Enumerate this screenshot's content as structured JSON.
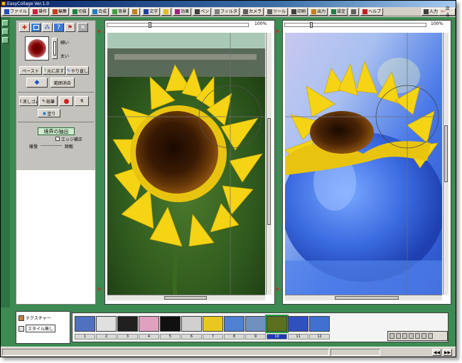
{
  "window": {
    "title": "EasyCollage Ver.1.0"
  },
  "toolbar": {
    "items": [
      {
        "label": "ファイル",
        "icon": "folder-icon",
        "color": "#2050c0"
      },
      {
        "label": "操作",
        "icon": "heart-icon",
        "color": "#d02040"
      },
      {
        "label": "編集",
        "icon": "scissors-icon",
        "color": "#c04020"
      },
      {
        "label": "切抜",
        "icon": "crop-icon",
        "color": "#208040"
      },
      {
        "label": "合成",
        "icon": "layers-icon",
        "color": "#2080c0"
      },
      {
        "label": "背景",
        "icon": "landscape-icon",
        "color": "#40a040"
      },
      {
        "label": "",
        "icon": "frame-icon",
        "color": "#c08020"
      },
      {
        "label": "文字",
        "icon": "text-icon",
        "color": "#2040a0"
      },
      {
        "label": "",
        "icon": "star-icon",
        "color": "#e0c020"
      },
      {
        "label": "効果",
        "icon": "effect-icon",
        "color": "#a02080"
      },
      {
        "label": "ペン",
        "icon": "pen-icon",
        "color": "#404040"
      },
      {
        "label": "フィルタ",
        "icon": "filter-icon",
        "color": "#808080"
      },
      {
        "label": "カメラ",
        "icon": "camera-icon",
        "color": "#606060"
      },
      {
        "label": "ツール",
        "icon": "tool-icon",
        "color": "#606060"
      },
      {
        "label": "印刷",
        "icon": "print-icon",
        "color": "#404040"
      },
      {
        "label": "出力",
        "icon": "export-icon",
        "color": "#c08020"
      },
      {
        "label": "設定",
        "icon": "settings-icon",
        "color": "#208040"
      },
      {
        "label": "",
        "icon": "grid-icon",
        "color": "#606060"
      },
      {
        "label": "ヘルプ",
        "icon": "help-icon",
        "color": "#c02020"
      }
    ],
    "right_items": [
      {
        "label": "入力",
        "icon": "input-icon"
      },
      {
        "label": "戻る",
        "icon": "back-arrow-icon"
      }
    ]
  },
  "left_panel": {
    "size_small": "細い",
    "size_large": "太い",
    "buttons_row1": [
      "ペースト",
      "元に戻す",
      "やり直し"
    ],
    "buttons_row2": [
      "",
      "範囲消去"
    ],
    "buttons_row3": [
      "消しゴム",
      "鉛筆",
      "",
      ""
    ],
    "fill_label": "塗り",
    "action_label": "境界の抽出",
    "edge_label": "エッジ補正",
    "slider_left": "緩慢",
    "slider_right": "鋭敏"
  },
  "left_view": {
    "zoom_label": "100%",
    "slider": 0.3
  },
  "right_view": {
    "zoom_label": "100%",
    "slider": 0.18
  },
  "layer_panel": {
    "rows": [
      {
        "label": "テクスチャー"
      },
      {
        "label": "スタイル無し"
      }
    ]
  },
  "filmstrip": {
    "selected": 9,
    "items": [
      {
        "num": "1"
      },
      {
        "num": "2"
      },
      {
        "num": "3"
      },
      {
        "num": "4"
      },
      {
        "num": "5"
      },
      {
        "num": "6"
      },
      {
        "num": "7"
      },
      {
        "num": "8"
      },
      {
        "num": "9"
      },
      {
        "num": "10"
      },
      {
        "num": "11"
      },
      {
        "num": "12"
      }
    ]
  },
  "status": {
    "nav_prev": "◀◀",
    "nav_next": "▶▶"
  }
}
